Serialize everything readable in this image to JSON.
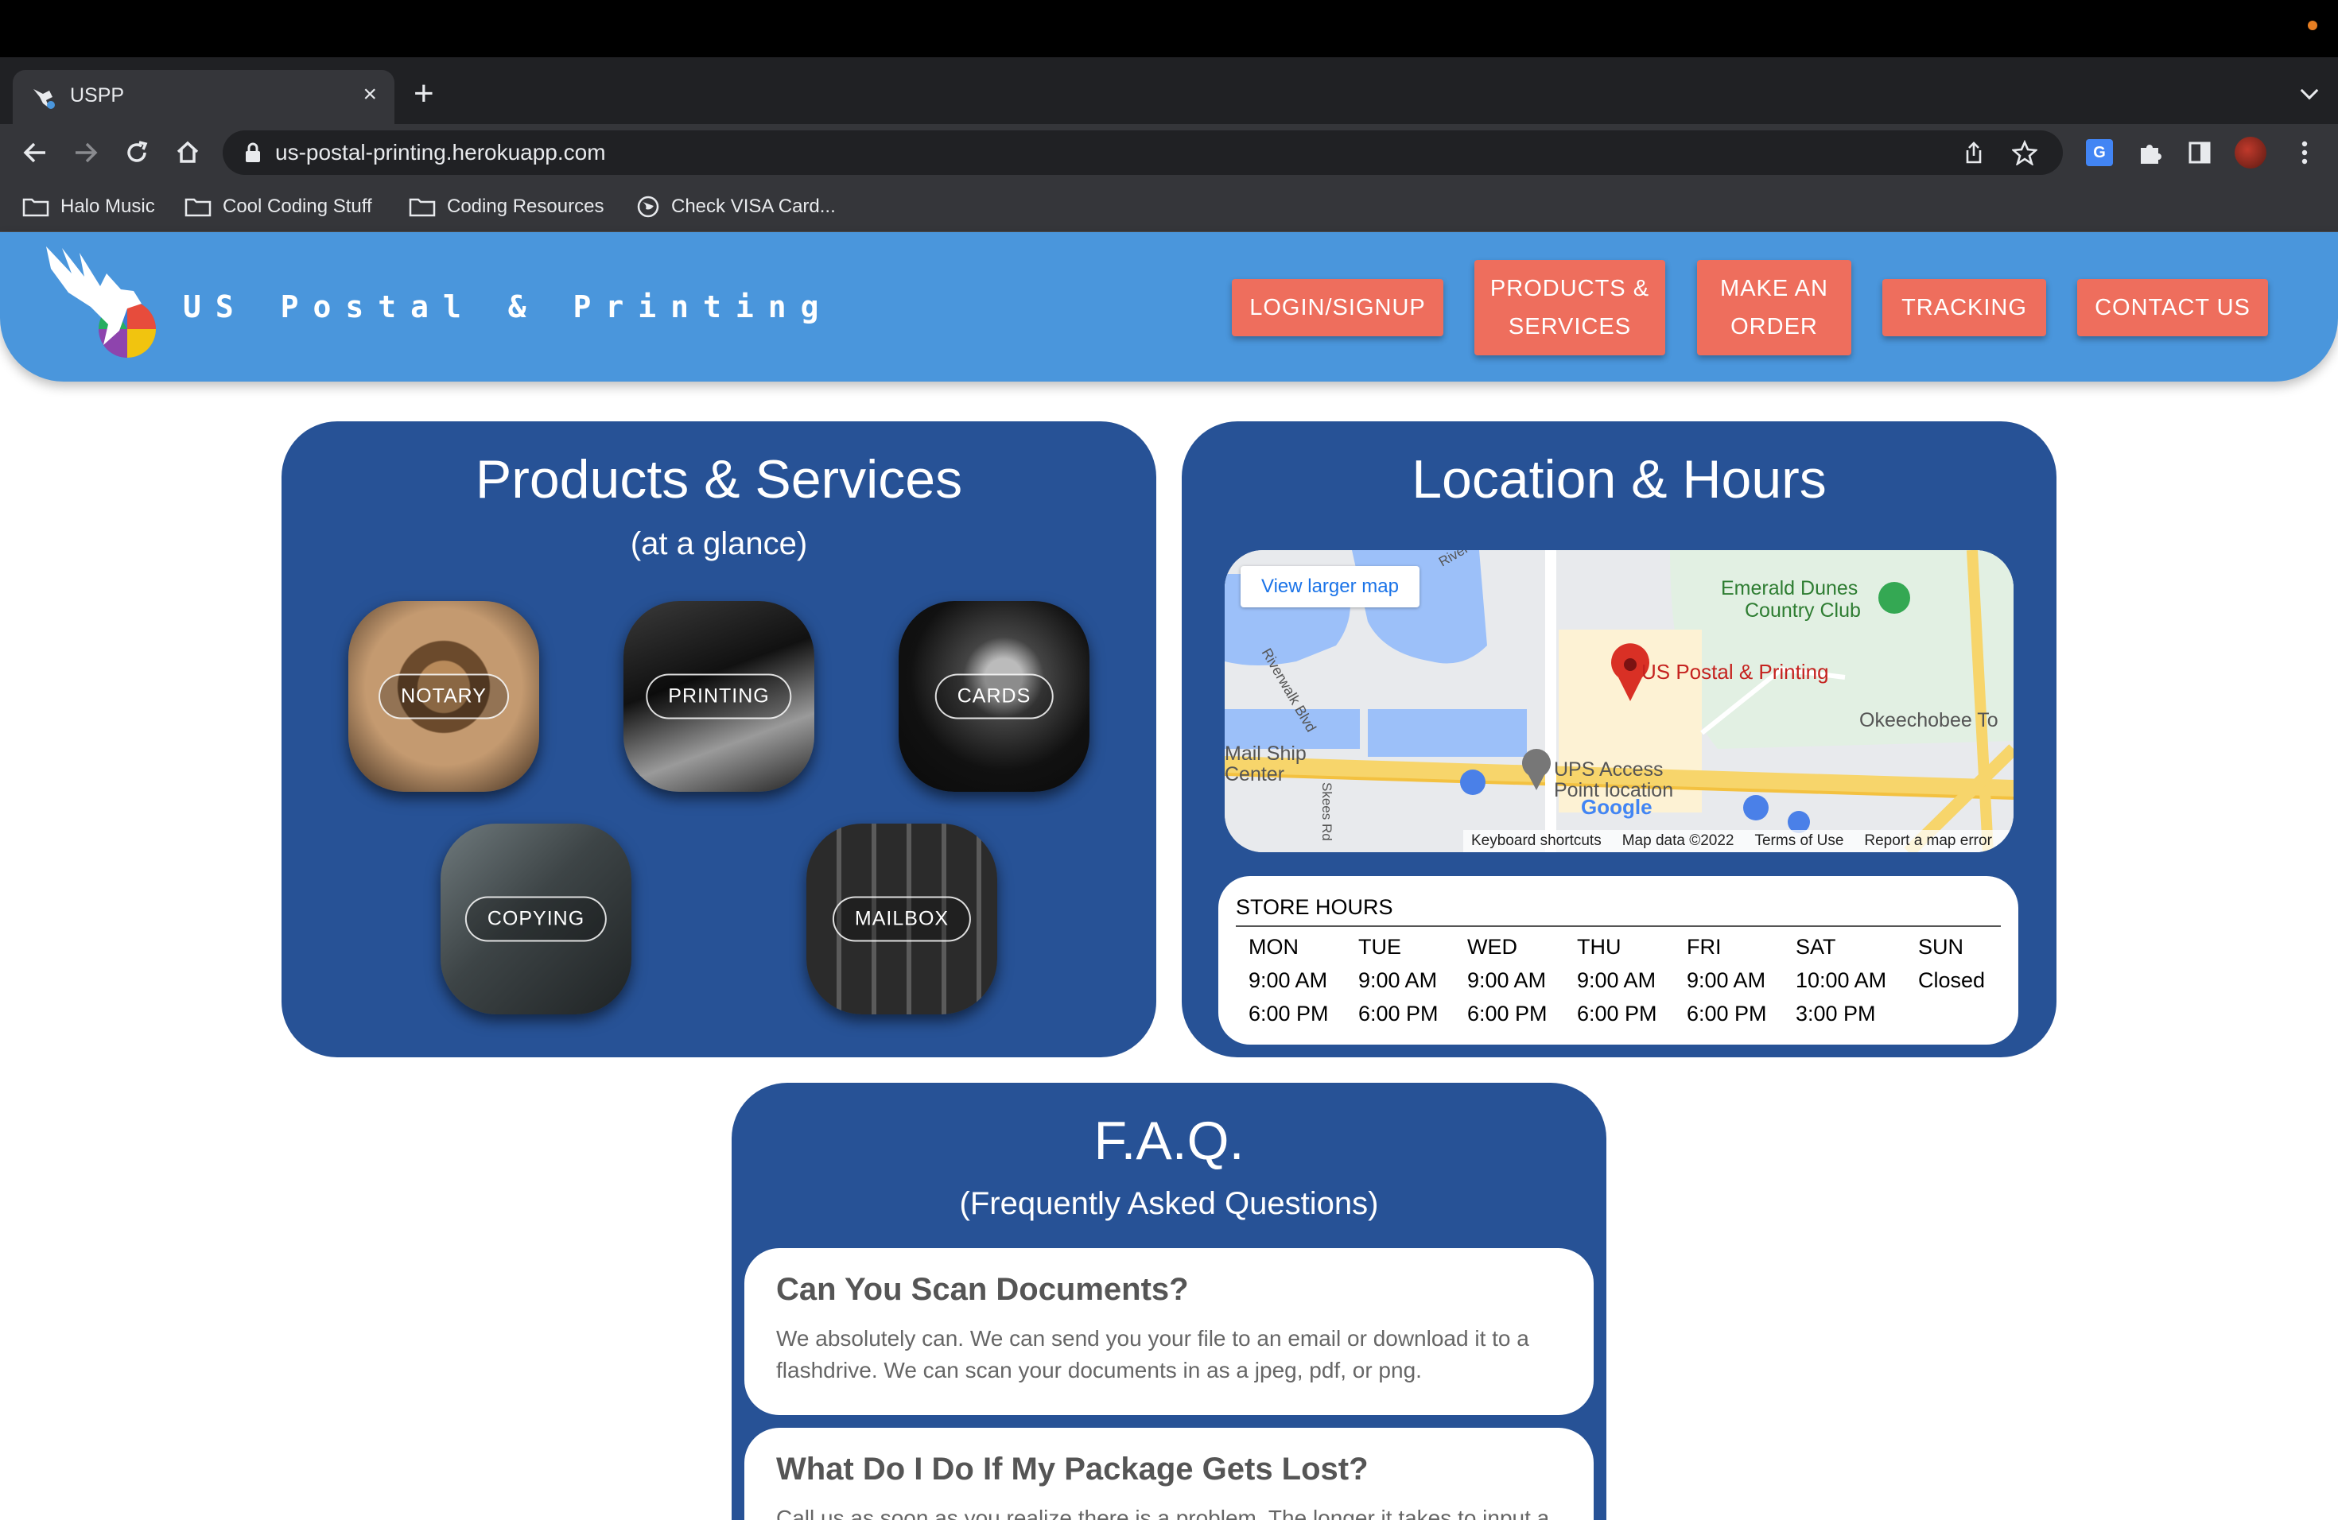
{
  "browser": {
    "tab_title": "USPP",
    "url": "us-postal-printing.herokuapp.com",
    "bookmarks": [
      "Halo Music",
      "Cool Coding Stuff",
      "Coding Resources",
      "Check VISA Card..."
    ]
  },
  "header": {
    "brand": "US Postal & Printing",
    "nav": {
      "login": "LOGIN/SIGNUP",
      "products_1": "PRODUCTS &",
      "products_2": "SERVICES",
      "order_1": "MAKE AN",
      "order_2": "ORDER",
      "tracking": "TRACKING",
      "contact": "CONTACT US"
    }
  },
  "products": {
    "title": "Products & Services",
    "subtitle": "(at a glance)",
    "items": [
      "NOTARY",
      "PRINTING",
      "CARDS",
      "COPYING",
      "MAILBOX"
    ]
  },
  "location": {
    "title": "Location & Hours",
    "map": {
      "view_larger": "View larger map",
      "pin_label": "US Postal & Printing",
      "places": [
        "Emerald Dunes",
        "Country Club",
        "Okeechobee To",
        "Mail Ship",
        "Center",
        "UPS Access",
        "Point location"
      ],
      "roads": [
        "Riverwalk Blvd",
        "Skees Rd",
        "River"
      ],
      "google": "Google",
      "footer": [
        "Keyboard shortcuts",
        "Map data ©2022",
        "Terms of Use",
        "Report a map error"
      ]
    },
    "hours": {
      "title": "STORE HOURS",
      "days": [
        {
          "day": "MON",
          "open": "9:00 AM",
          "close": "6:00 PM"
        },
        {
          "day": "TUE",
          "open": "9:00 AM",
          "close": "6:00 PM"
        },
        {
          "day": "WED",
          "open": "9:00 AM",
          "close": "6:00 PM"
        },
        {
          "day": "THU",
          "open": "9:00 AM",
          "close": "6:00 PM"
        },
        {
          "day": "FRI",
          "open": "9:00 AM",
          "close": "6:00 PM"
        },
        {
          "day": "SAT",
          "open": "10:00 AM",
          "close": "3:00 PM"
        },
        {
          "day": "SUN",
          "open": "Closed",
          "close": ""
        }
      ]
    }
  },
  "faq": {
    "title": "F.A.Q.",
    "subtitle": "(Frequently Asked Questions)",
    "items": [
      {
        "q": "Can You Scan Documents?",
        "a": "We absolutely can. We can send you your file to an email or download it to a flashdrive. We can scan your documents in as a jpeg, pdf, or png."
      },
      {
        "q": "What Do I Do If My Package Gets Lost?",
        "a": "Call us as soon as you realize there is a problem. The longer it takes to input a"
      }
    ]
  },
  "colors": {
    "header": "#4a96dc",
    "card": "#275296",
    "nav_button": "#ee6e5d",
    "map_pin": "#d93025"
  }
}
